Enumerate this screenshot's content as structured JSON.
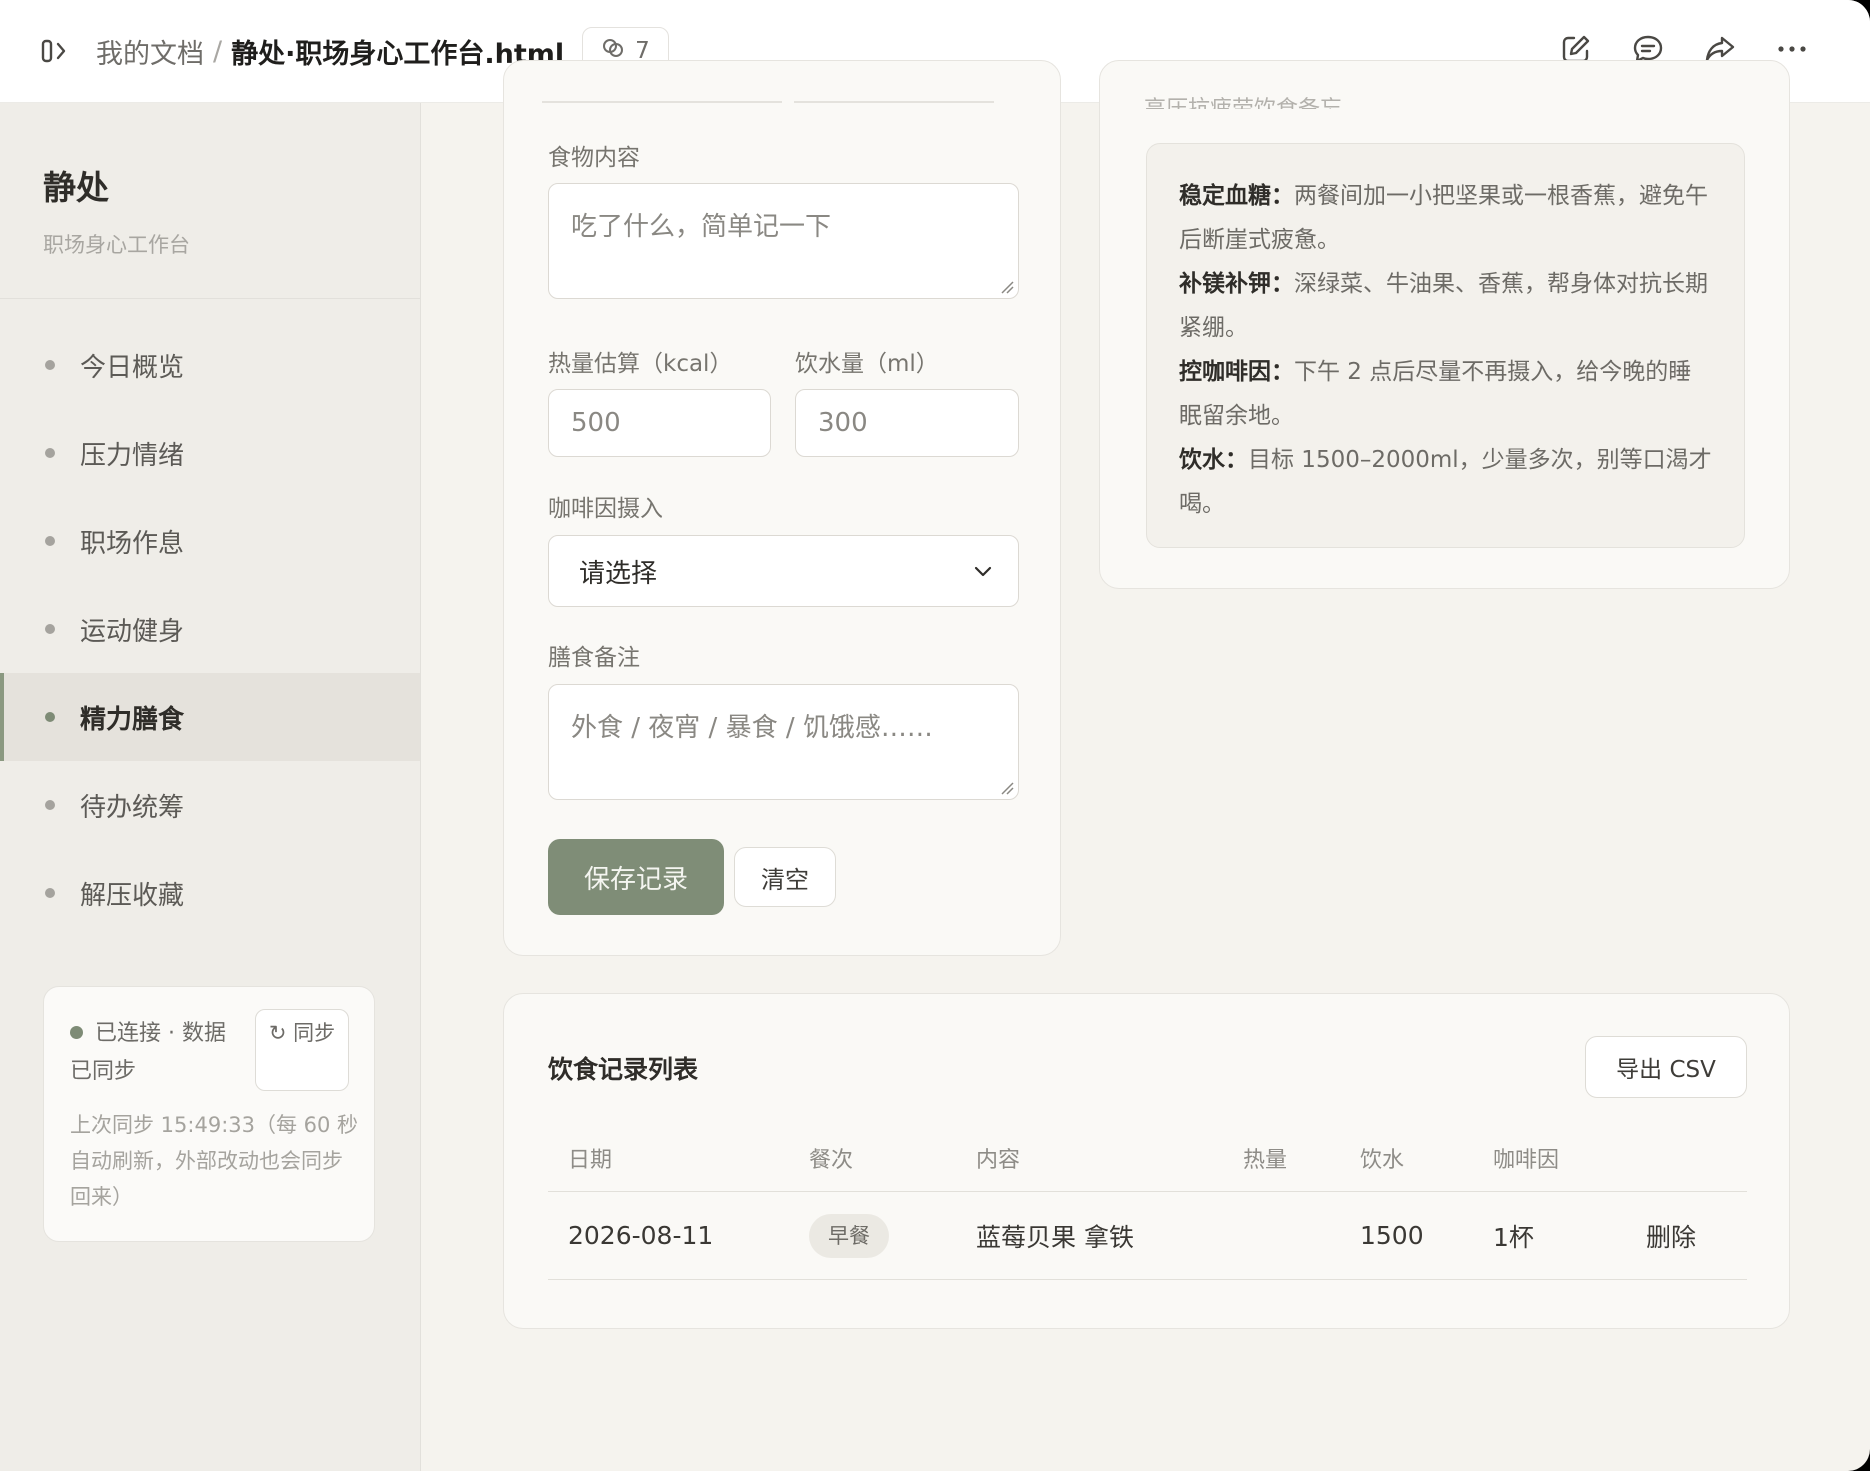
{
  "topbar": {
    "breadcrumb_parent": "我的文档",
    "breadcrumb_sep": "/",
    "breadcrumb_current": "静处·职场身心工作台.html",
    "collab_count": "7"
  },
  "sidebar": {
    "brand_title": "静处",
    "brand_subtitle": "职场身心工作台",
    "items": [
      {
        "label": "今日概览"
      },
      {
        "label": "压力情绪"
      },
      {
        "label": "职场作息"
      },
      {
        "label": "运动健身"
      },
      {
        "label": "精力膳食",
        "active": true
      },
      {
        "label": "待办统筹"
      },
      {
        "label": "解压收藏"
      }
    ],
    "sync": {
      "status": "已连接 · 数据已同步",
      "button_icon": "↻",
      "button_label": "同步",
      "note": "上次同步 15:49:33（每 60 秒自动刷新，外部改动也会同步回来）"
    }
  },
  "form": {
    "food_label": "食物内容",
    "food_placeholder": "吃了什么，简单记一下",
    "calorie_label": "热量估算（kcal）",
    "calorie_placeholder": "500",
    "water_label": "饮水量（ml）",
    "water_placeholder": "300",
    "caffeine_label": "咖啡因摄入",
    "caffeine_selected": "请选择",
    "notes_label": "膳食备注",
    "notes_placeholder": "外食 / 夜宵 / 暴食 / 饥饿感……",
    "save_label": "保存记录",
    "clear_label": "清空"
  },
  "tips": {
    "clipped_heading": "高压抗疲劳饮食备忘",
    "items": [
      {
        "title": "稳定血糖：",
        "text": "两餐间加一小把坚果或一根香蕉，避免午后断崖式疲惫。"
      },
      {
        "title": "补镁补钾：",
        "text": "深绿菜、牛油果、香蕉，帮身体对抗长期紧绷。"
      },
      {
        "title": "控咖啡因：",
        "text": "下午 2 点后尽量不再摄入，给今晚的睡眠留余地。"
      },
      {
        "title": "饮水：",
        "text": "目标 1500–2000ml，少量多次，别等口渴才喝。"
      }
    ]
  },
  "records": {
    "title": "饮食记录列表",
    "export_label": "导出 CSV",
    "columns": [
      "日期",
      "餐次",
      "内容",
      "热量",
      "饮水",
      "咖啡因"
    ],
    "rows": [
      {
        "date": "2026-08-11",
        "meal": "早餐",
        "content": "蓝莓贝果 拿铁",
        "calories": "",
        "water": "1500",
        "caffeine": "1杯",
        "action": "删除"
      }
    ]
  },
  "colors": {
    "accent": "#7f8d77",
    "background": "#f5f3ee",
    "sidebar": "#efede8",
    "link": "#8c9aac"
  }
}
